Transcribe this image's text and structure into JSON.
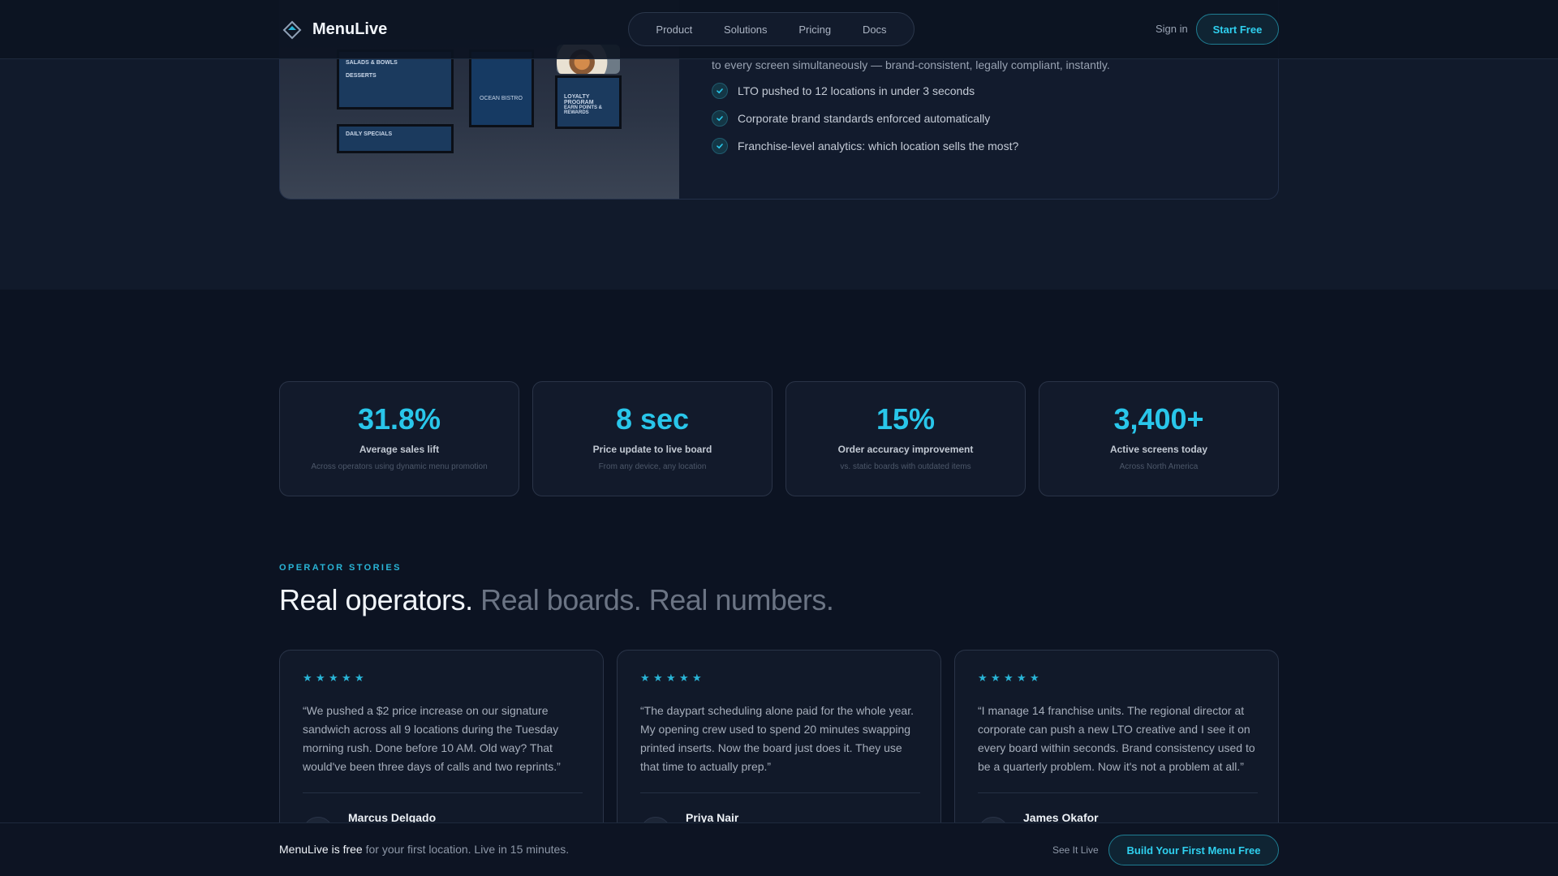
{
  "nav": {
    "brand": "MenuLive",
    "links": [
      "Product",
      "Solutions",
      "Pricing",
      "Docs"
    ],
    "signin": "Sign in",
    "start": "Start Free"
  },
  "feature": {
    "subtitle": "to every screen simultaneously — brand-consistent, legally compliant, instantly.",
    "checks": [
      "LTO pushed to 12 locations in under 3 seconds",
      "Corporate brand standards enforced automatically",
      "Franchise-level analytics: which location sells the most?"
    ],
    "image": {
      "board1_lines": [
        "SALADS & BOWLS",
        "DESSERTS"
      ],
      "board2_title": "OCEAN BISTRO",
      "board3_lines": [
        "LOYALTY PROGRAM",
        "EARN POINTS & REWARDS"
      ],
      "board4_lines": [
        "DAILY SPECIALS"
      ]
    }
  },
  "stats": [
    {
      "value": "31.8%",
      "label": "Average sales lift",
      "sub": "Across operators using dynamic menu promotion"
    },
    {
      "value": "8 sec",
      "label": "Price update to live board",
      "sub": "From any device, any location"
    },
    {
      "value": "15%",
      "label": "Order accuracy improvement",
      "sub": "vs. static boards with outdated items"
    },
    {
      "value": "3,400+",
      "label": "Active screens today",
      "sub": "Across North America"
    }
  ],
  "stories": {
    "kicker": "OPERATOR STORIES",
    "heading_main": "Real operators.",
    "heading_sub": "Real boards. Real numbers.",
    "star_glyph": "★",
    "cards": [
      {
        "quote": "“We pushed a $2 price increase on our signature sandwich across all 9 locations during the Tuesday morning rush. Done before 10 AM. Old way? That would've been three days of calls and two reprints.”",
        "name": "Marcus Delgado"
      },
      {
        "quote": "“The daypart scheduling alone paid for the whole year. My opening crew used to spend 20 minutes swapping printed inserts. Now the board just does it. They use that time to actually prep.”",
        "name": "Priya Nair"
      },
      {
        "quote": "“I manage 14 franchise units. The regional director at corporate can push a new LTO creative and I see it on every board within seconds. Brand consistency used to be a quarterly problem. Now it's not a problem at all.”",
        "name": "James Okafor"
      }
    ]
  },
  "bottom": {
    "bold": "MenuLive is free",
    "rest": " for your first location. Live in 15 minutes.",
    "see_live": "See It Live",
    "build": "Build Your First Menu Free"
  }
}
